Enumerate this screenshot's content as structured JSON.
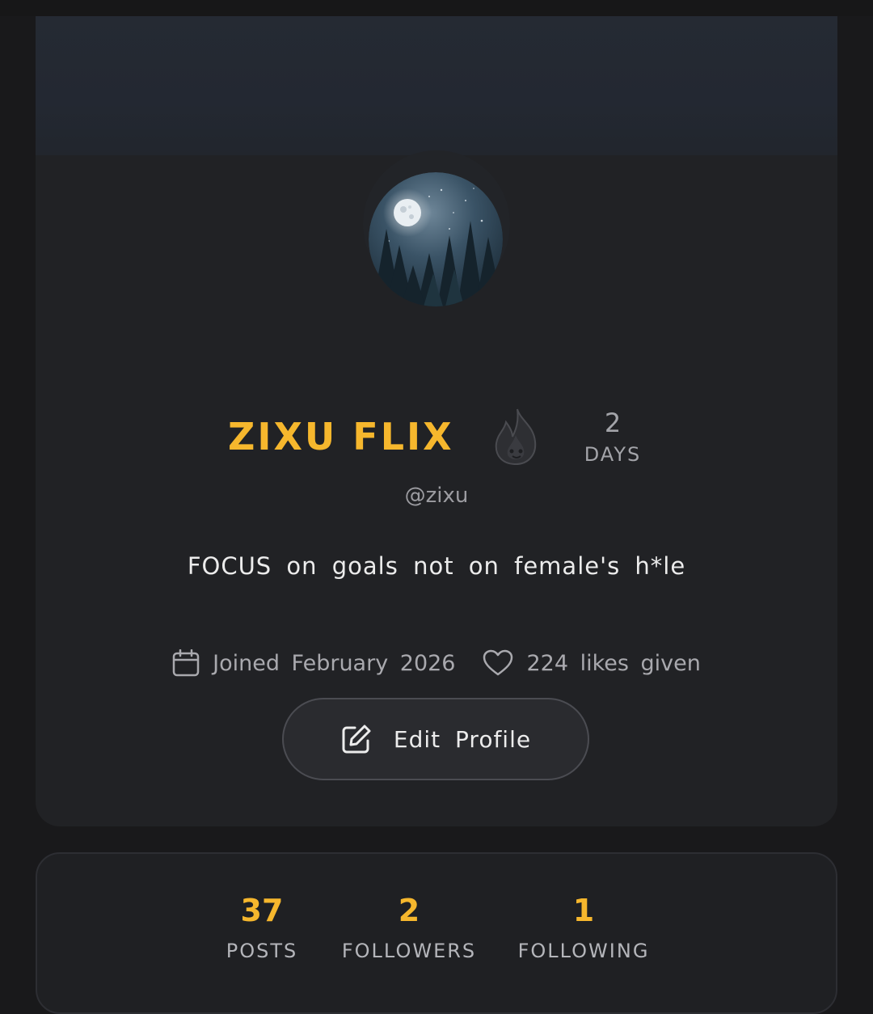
{
  "profile": {
    "display_name": "ZIXU FLIX",
    "handle": "@zixu",
    "bio": "FOCUS on goals not on female's h*le",
    "streak": {
      "count": "2",
      "unit": "DAYS",
      "icon": "flame-icon"
    },
    "joined": {
      "text": "Joined February 2026",
      "icon": "calendar-icon"
    },
    "likes": {
      "text": "224 likes given",
      "icon": "heart-icon"
    },
    "edit_button": {
      "label": "Edit Profile",
      "icon": "edit-icon"
    },
    "avatar": {
      "icon": "moonlit-forest-avatar"
    }
  },
  "stats": [
    {
      "value": "37",
      "label": "POSTS"
    },
    {
      "value": "2",
      "label": "FOLLOWERS"
    },
    {
      "value": "1",
      "label": "FOLLOWING"
    }
  ],
  "colors": {
    "accent": "#f6b72d",
    "background": "#19191b",
    "card": "#212225",
    "muted_text": "#a3a4a9"
  }
}
